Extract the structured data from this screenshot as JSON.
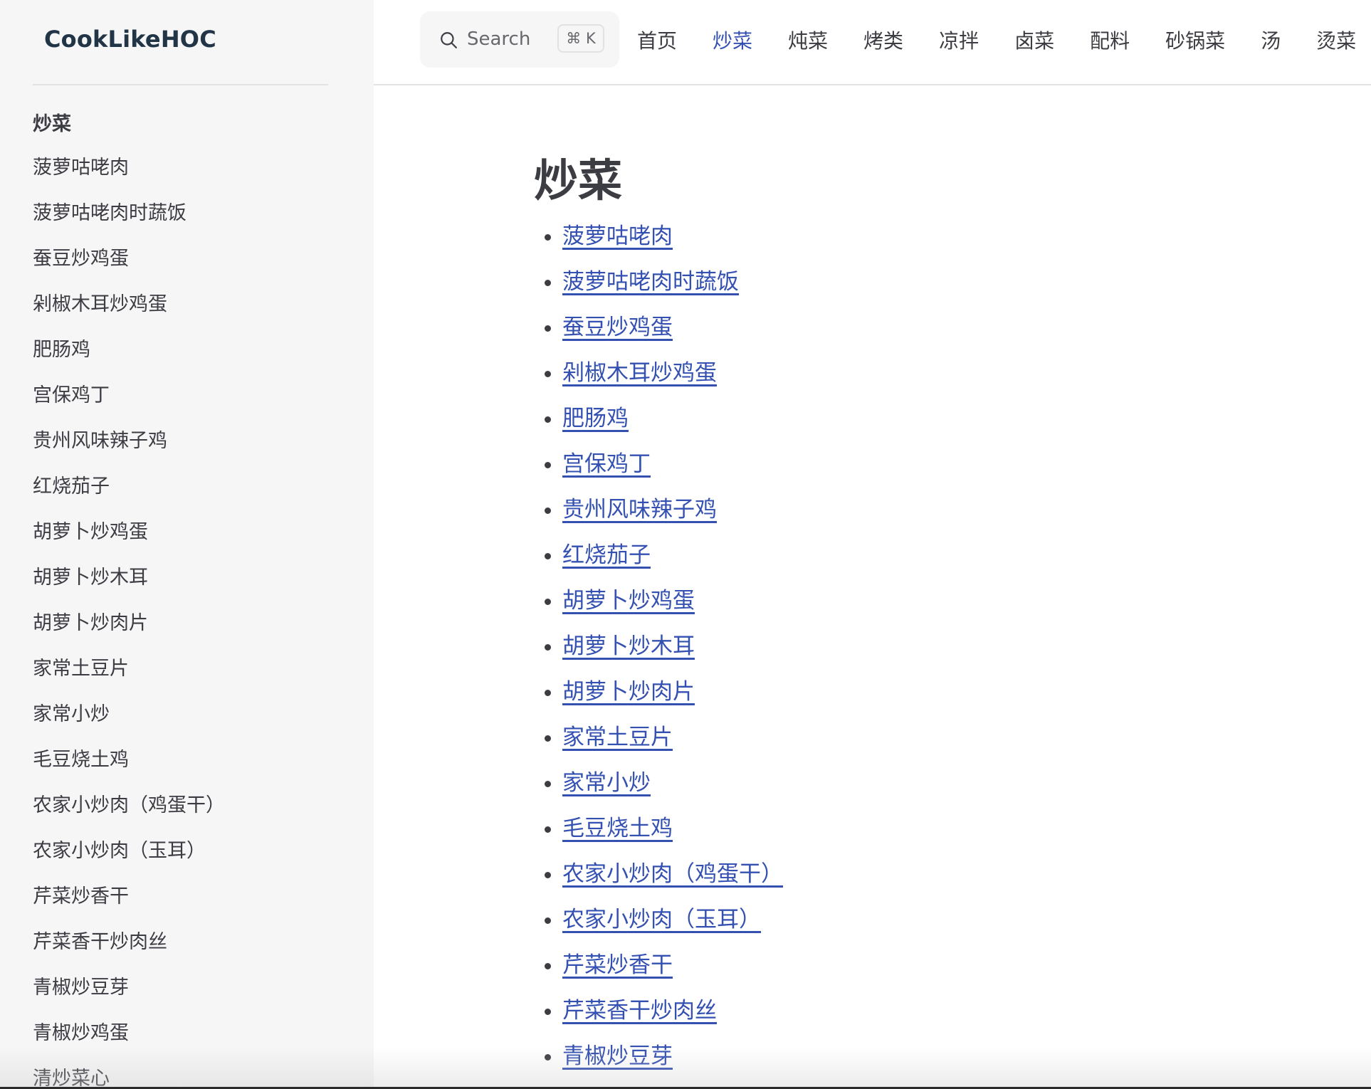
{
  "brand": "CookLikeHOC",
  "search": {
    "label": "Search",
    "shortcut": "⌘ K"
  },
  "nav": {
    "items": [
      {
        "label": "首页",
        "active": false
      },
      {
        "label": "炒菜",
        "active": true
      },
      {
        "label": "炖菜",
        "active": false
      },
      {
        "label": "烤类",
        "active": false
      },
      {
        "label": "凉拌",
        "active": false
      },
      {
        "label": "卤菜",
        "active": false
      },
      {
        "label": "配料",
        "active": false
      },
      {
        "label": "砂锅菜",
        "active": false
      },
      {
        "label": "汤",
        "active": false
      },
      {
        "label": "烫菜",
        "active": false
      }
    ]
  },
  "sidebar": {
    "section_title": "炒菜",
    "items": [
      "菠萝咕咾肉",
      "菠萝咕咾肉时蔬饭",
      "蚕豆炒鸡蛋",
      "剁椒木耳炒鸡蛋",
      "肥肠鸡",
      "宫保鸡丁",
      "贵州风味辣子鸡",
      "红烧茄子",
      "胡萝卜炒鸡蛋",
      "胡萝卜炒木耳",
      "胡萝卜炒肉片",
      "家常土豆片",
      "家常小炒",
      "毛豆烧土鸡",
      "农家小炒肉（鸡蛋干）",
      "农家小炒肉（玉耳）",
      "芹菜炒香干",
      "芹菜香干炒肉丝",
      "青椒炒豆芽",
      "青椒炒鸡蛋",
      "清炒菜心"
    ]
  },
  "main": {
    "title": "炒菜",
    "links": [
      "菠萝咕咾肉",
      "菠萝咕咾肉时蔬饭",
      "蚕豆炒鸡蛋",
      "剁椒木耳炒鸡蛋",
      "肥肠鸡",
      "宫保鸡丁",
      "贵州风味辣子鸡",
      "红烧茄子",
      "胡萝卜炒鸡蛋",
      "胡萝卜炒木耳",
      "胡萝卜炒肉片",
      "家常土豆片",
      "家常小炒",
      "毛豆烧土鸡",
      "农家小炒肉（鸡蛋干）",
      "农家小炒肉（玉耳）",
      "芹菜炒香干",
      "芹菜香干炒肉丝",
      "青椒炒豆芽"
    ]
  },
  "colors": {
    "accent": "#3451b2",
    "text": "#3c3c43",
    "sidebar_bg": "#f6f6f7"
  }
}
